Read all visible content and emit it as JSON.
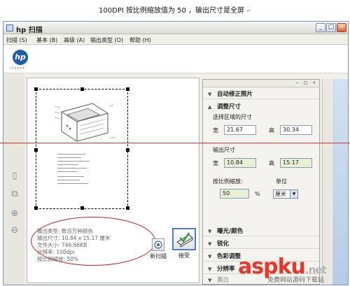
{
  "caption": "100DPI   按比例缩放值为 50  ，输出尺寸是全屏",
  "caption_tick": "↵",
  "window": {
    "title": "hp 扫描",
    "controls": {
      "minimize": "_",
      "maximize": "□",
      "close": "×"
    }
  },
  "menu": [
    "扫描 (S)",
    "基本 (B)",
    "高级 (A)",
    "输出类型 (O)",
    "帮助 (H)"
  ],
  "logo": {
    "mark": "hp",
    "sub": "invent"
  },
  "tools": [
    "scan-page-icon",
    "scan-frame-icon",
    "zoom-in-icon",
    "zoom-out-icon"
  ],
  "scan_info": {
    "output_type": "输出类型: 数百万种颜色",
    "output_size": "输出尺寸: 10.84 x 15.17 厘米",
    "file_size": "文件大小:  746.66KB",
    "resolution": "分辨率:  100dpi",
    "scale": "按比例缩放: 50%"
  },
  "actions": {
    "new_scan": "新扫描",
    "accept": "接受"
  },
  "panel": {
    "controls": [
      "−",
      "□",
      "×"
    ],
    "sections": {
      "auto_fix": "自动修正照片",
      "resize": "调整尺寸",
      "exposure": "曝光/颜色",
      "sharpen": "锐化",
      "color_adjust": "色彩调整",
      "resolution": "分辨率",
      "black_white": "黑白"
    },
    "select_area_label": "选择区域的尺寸",
    "width_label": "宽",
    "height_label": "高",
    "selection": {
      "width": "21.67",
      "height": "30.34"
    },
    "output_size_label": "输出尺寸",
    "output": {
      "width": "10.84",
      "height": "15.17"
    },
    "scale_label": "按比例缩放:",
    "scale_value": "50",
    "percent": "%",
    "unit_label": "单位",
    "unit_value": "厘米"
  },
  "watermark": {
    "brand": "aspku",
    "suffix": ".net",
    "sub": "免费网站源码下载站"
  }
}
